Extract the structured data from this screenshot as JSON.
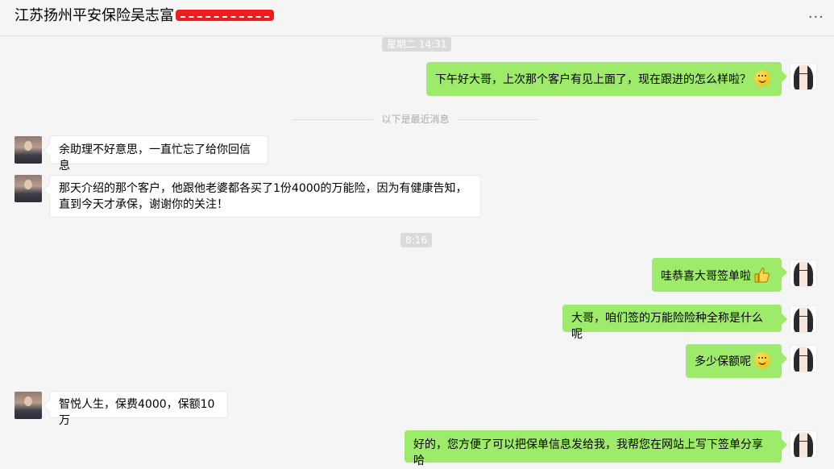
{
  "chat": {
    "title": "江苏扬州平安保险吴志富"
  },
  "header": {
    "more_label": "···"
  },
  "timestamps": {
    "t1": "星期二 14:31",
    "t2": "8:16"
  },
  "divider": {
    "label": "以下是最近消息"
  },
  "messages": [
    {
      "side": "out",
      "text": "下午好大哥，上次那个客户有见上面了，现在跟进的怎么样啦？",
      "emoji": "smiley-icon"
    },
    {
      "side": "in",
      "text": "余助理不好意思，一直忙忘了给你回信息"
    },
    {
      "side": "in",
      "text": "那天介绍的那个客户，他跟他老婆都各买了1份4000的万能险，因为有健康告知，直到今天才承保，谢谢你的关注！"
    },
    {
      "side": "out",
      "text": "哇恭喜大哥签单啦",
      "emoji": "thumbs-up-icon"
    },
    {
      "side": "out",
      "text": "大哥，咱们签的万能险险种全称是什么呢"
    },
    {
      "side": "out",
      "text": "多少保额呢",
      "emoji": "smiley-icon"
    },
    {
      "side": "in",
      "text": "智悦人生，保费4000，保额10万"
    },
    {
      "side": "out",
      "text": "好的，您方便了可以把保单信息发给我，我帮您在网站上写下签单分享哈"
    }
  ],
  "colors": {
    "outgoing_bubble": "#9eea6a",
    "incoming_bubble": "#ffffff",
    "background": "#f5f5f5",
    "redaction": "#ee1c1c"
  }
}
